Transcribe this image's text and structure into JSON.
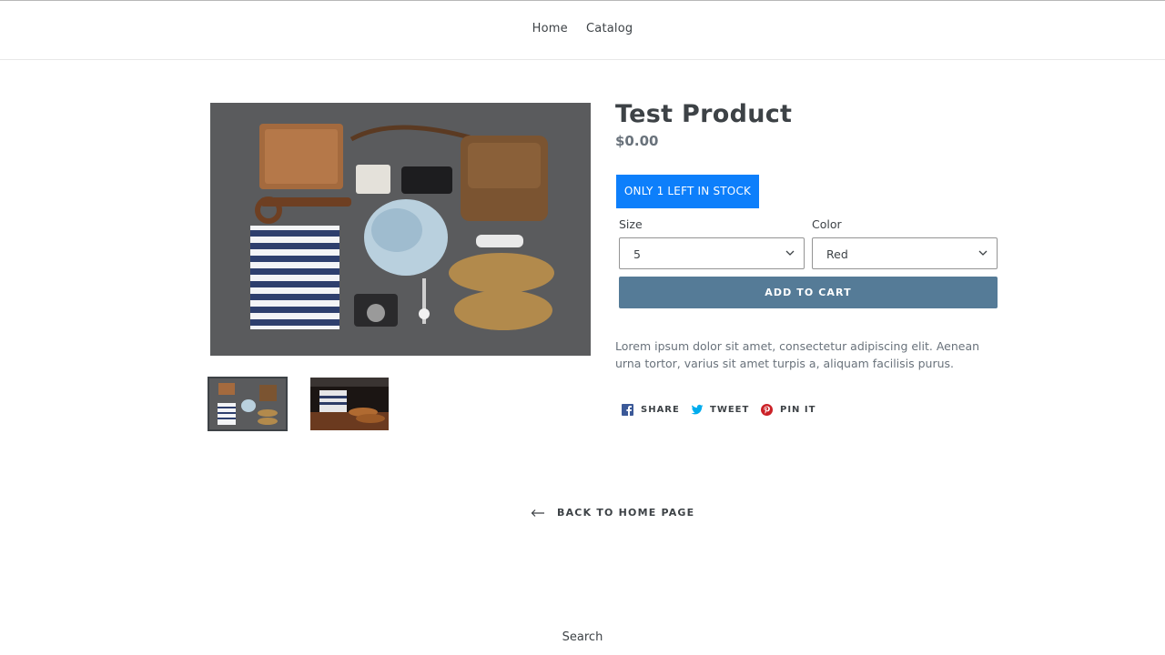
{
  "nav": {
    "links": [
      "Home",
      "Catalog"
    ]
  },
  "product": {
    "title": "Test Product",
    "price": "$0.00",
    "stock_badge": "ONLY 1 LEFT IN STOCK",
    "options": {
      "size_label": "Size",
      "size_value": "5",
      "color_label": "Color",
      "color_value": "Red"
    },
    "add_to_cart": "ADD TO CART",
    "description": "Lorem ipsum dolor sit amet, consectetur adipiscing elit. Aenean urna tortor, varius sit amet turpis a, aliquam facilisis purus."
  },
  "share": {
    "facebook": "SHARE",
    "twitter": "TWEET",
    "pinterest": "PIN IT"
  },
  "back_link": "BACK TO HOME PAGE",
  "footer": {
    "search": "Search"
  },
  "colors": {
    "accent": "#557b97",
    "stock_badge": "#0d7ffb",
    "facebook": "#3b5998",
    "twitter": "#00aced",
    "pinterest": "#cb2127"
  },
  "icons": [
    "facebook-icon",
    "twitter-icon",
    "pinterest-icon",
    "chevron-down-icon",
    "arrow-left-icon"
  ]
}
